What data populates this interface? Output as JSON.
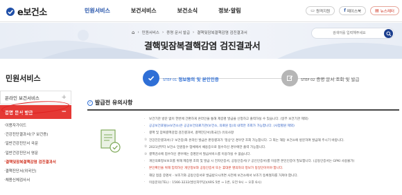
{
  "header": {
    "logo": "e보건소",
    "nav": [
      {
        "label": "민원서비스",
        "active": true
      },
      {
        "label": "보건서비스",
        "active": false
      },
      {
        "label": "보건소식",
        "active": false
      },
      {
        "label": "정보·알림",
        "active": false
      }
    ],
    "top_links": [
      {
        "icon": "printer-icon",
        "label": "원격지원"
      },
      {
        "icon": "facebook-icon",
        "label": "페이스북"
      },
      {
        "icon": "news-icon",
        "label": "뉴스레터"
      }
    ]
  },
  "banner": {
    "breadcrumb": [
      "민원서비스",
      "증명 문서 발급",
      "결핵및잠복결핵감염 검진결과서"
    ],
    "title": "결핵및잠복결핵감염 검진결과서",
    "search_placeholder": "검색어를 입력해주세요"
  },
  "sidebar": {
    "title": "민원서비스",
    "groups": [
      {
        "label": "온라인 보건서비스",
        "sign": "+"
      },
      {
        "label": "증명 문서 발급",
        "sign": "−"
      }
    ],
    "items": [
      "이용자가이드",
      "건강진단결과서(구 보건증)",
      "일반건강진단서 국문",
      "일반건강진단서 영문",
      "결핵및잠복결핵감염 검진결과서",
      "결핵진단서(외국인)",
      "채용신체검사서"
    ],
    "current_index": 4
  },
  "steps": [
    {
      "num": "STEP 01",
      "label": "정보동의 및 본인인증",
      "state": "active",
      "icon": "check-icon"
    },
    {
      "num": "STEP 02",
      "label": "증명 문서 조회 및 발급",
      "state": "inactive",
      "icon": "pencil-icon"
    }
  ],
  "notice": {
    "title": "발급전 유의사항",
    "lines": [
      {
        "bullet": "·",
        "text": "보건기관 방문 없이 한번에 간편하게 온라인을 통해 제증명 발급을 신청하고 출력하실 수 있습니다. (일부 보건기관 제외)",
        "style": "normal"
      },
      {
        "bullet": "·",
        "text": "공공보건포털(e보건소)은 공공보건의료기관(보건소, 의료원 등)의 내역만 조회가 가능합니다. (사업별원 제외)",
        "style": "blue"
      },
      {
        "bullet": "·",
        "text": "결핵 및 잠복결핵감염 검진결과서, 결핵진단서(외국인) 유의사항",
        "style": "normal"
      },
      {
        "bullet": "①",
        "text": "건강진단결과서(구 보건증)와 온라인 발급은 판정결과가 '정상'인 경우만 조회 가능합니다. 그 외는 해당 보건소에 방문하여 발급해 주시기 바랍니다.",
        "style": "normal"
      },
      {
        "bullet": "②",
        "text": "2021년부터 보건소 민원접수 업체에서 채용증으로 접수하신 경우에만 출력 가능합니다.",
        "style": "normal"
      },
      {
        "bullet": "③",
        "text": "결핵검사에 접수하신 경우에는 증명문서 발급서비스를 이용하실 수 없습니다.",
        "style": "normal"
      },
      {
        "bullet": "·",
        "text": "개인의료정보보호를 위해 제증명 조회 및 발급 시 전자인증서, 공동인증서(구 공인인증서)를 이용한 본인인증이 필요합니다. (공동인증서는 GPKI 사용불가)",
        "style": "normal"
      },
      {
        "bullet": "·",
        "text": "본인확인을 위해 입력하신 개인정보와 공동인증서 또는 휴대폰 명의자의 정보가 동일인이어야 합니다.",
        "style": "red"
      },
      {
        "bullet": "·",
        "text": "해당 접종 증명서 - 보조기와 공동인증서로 발급받으시려면 사전에 보건소에서 보조기 등록절차를 거쳐야 합니다.",
        "style": "normal"
      },
      {
        "bullet": "·",
        "text": "이용문의(TEL) : 1566-3232(발신자부담)(ARS 5번 → 1번, 오전 9시 ~ 오후 6시)",
        "style": "normal"
      }
    ]
  },
  "colors": {
    "brand_blue": "#1f4fa8",
    "step_blue": "#2f6fd6",
    "sidebar_red": "#e53935",
    "search_navy": "#1c3f8f"
  }
}
